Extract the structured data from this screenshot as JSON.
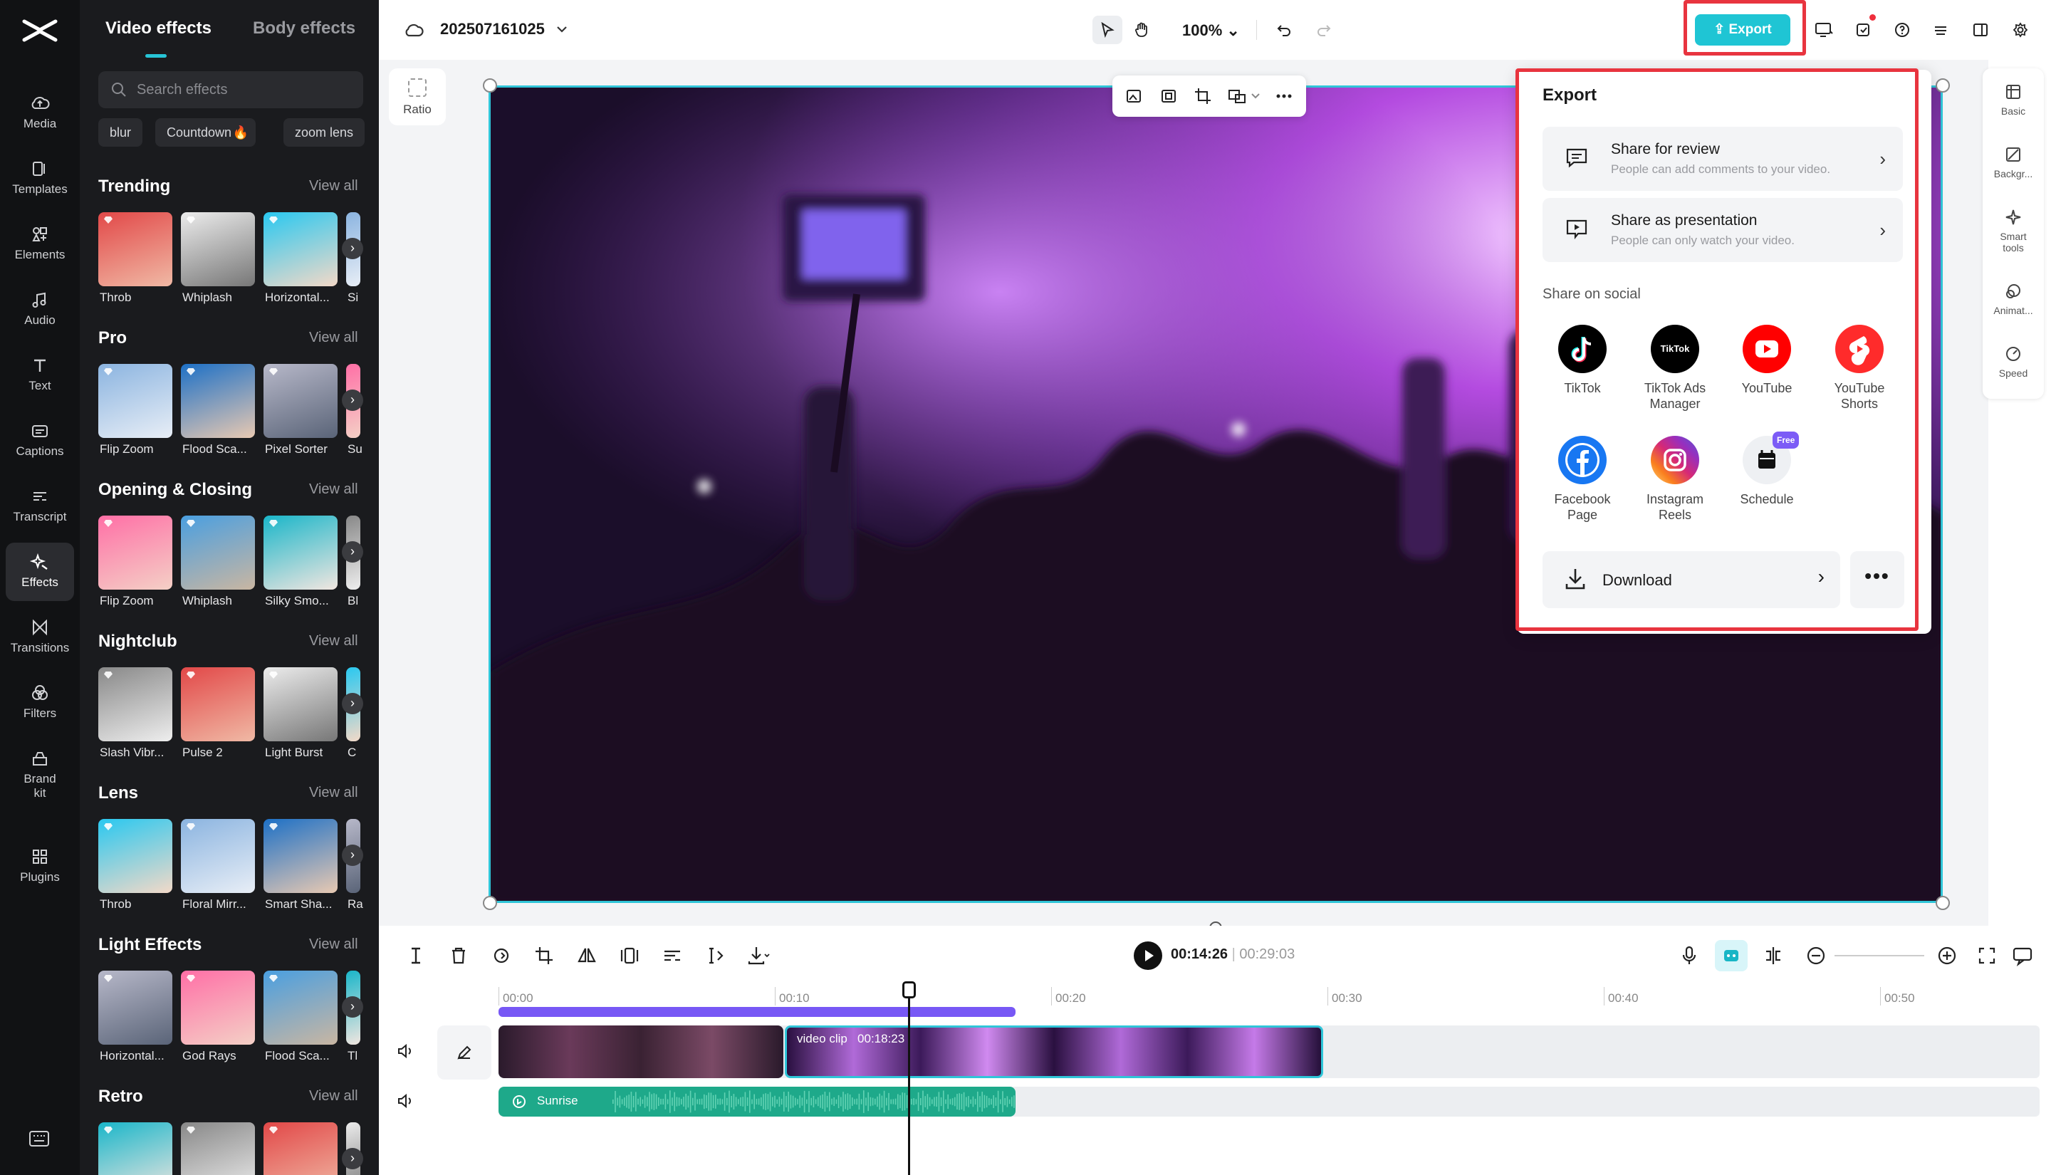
{
  "project": {
    "name": "202507161025",
    "zoom": "100%"
  },
  "rail": {
    "items": [
      {
        "name": "media",
        "label": "Media"
      },
      {
        "name": "templates",
        "label": "Templates"
      },
      {
        "name": "elements",
        "label": "Elements"
      },
      {
        "name": "audio",
        "label": "Audio"
      },
      {
        "name": "text",
        "label": "Text"
      },
      {
        "name": "captions",
        "label": "Captions"
      },
      {
        "name": "transcript",
        "label": "Transcript"
      },
      {
        "name": "effects",
        "label": "Effects",
        "active": true
      },
      {
        "name": "transitions",
        "label": "Transitions"
      },
      {
        "name": "filters",
        "label": "Filters"
      },
      {
        "name": "brand-kit",
        "label": "Brand\nkit"
      },
      {
        "name": "plugins",
        "label": "Plugins"
      }
    ]
  },
  "panel": {
    "tab_active": "Video effects",
    "tab_other": "Body effects",
    "search_placeholder": "Search effects",
    "chips": [
      "blur",
      "Countdown",
      "zoom lens"
    ],
    "view_all": "View all",
    "sections": [
      {
        "title": "Trending",
        "items": [
          "Throb",
          "Whiplash",
          "Horizontal...",
          "Si"
        ]
      },
      {
        "title": "Pro",
        "items": [
          "Flip Zoom",
          "Flood Sca...",
          "Pixel Sorter",
          "Su"
        ]
      },
      {
        "title": "Opening & Closing",
        "items": [
          "Flip Zoom",
          "Whiplash",
          "Silky Smo...",
          "Bl"
        ]
      },
      {
        "title": "Nightclub",
        "items": [
          "Slash Vibr...",
          "Pulse 2",
          "Light Burst",
          "C"
        ]
      },
      {
        "title": "Lens",
        "items": [
          "Throb",
          "Floral Mirr...",
          "Smart Sha...",
          "Ra"
        ]
      },
      {
        "title": "Light Effects",
        "items": [
          "Horizontal...",
          "God Rays",
          "Flood Sca...",
          "Tl"
        ]
      },
      {
        "title": "Retro",
        "items": [
          "",
          "",
          "",
          ""
        ]
      }
    ]
  },
  "toolbar": {
    "export_label": "Export",
    "ratio_label": "Ratio"
  },
  "right_rail": [
    "Basic",
    "Backgr...",
    "Smart\ntools",
    "Animat...",
    "Speed"
  ],
  "export_popup": {
    "title": "Export",
    "share_review": {
      "title": "Share for review",
      "subtitle": "People can add comments to your video."
    },
    "share_presentation": {
      "title": "Share as presentation",
      "subtitle": "People can only watch your video."
    },
    "social_heading": "Share on social",
    "social": [
      {
        "label": "TikTok",
        "color": "#000000"
      },
      {
        "label": "TikTok Ads\nManager",
        "color": "#000000"
      },
      {
        "label": "YouTube",
        "color": "#ff0000"
      },
      {
        "label": "YouTube\nShorts",
        "color": "#ff2b2b"
      },
      {
        "label": "Facebook\nPage",
        "color": "#1877f2"
      },
      {
        "label": "Instagram\nReels",
        "color": "#d62976"
      },
      {
        "label": "Schedule",
        "color": "#eef0f3",
        "badge": "Free"
      }
    ],
    "tiktok_ads_text": "TikTok",
    "download_label": "Download"
  },
  "timeline": {
    "current_time": "00:14:26",
    "total_time": "00:29:03",
    "ruler": [
      "00:00",
      "00:10",
      "00:20",
      "00:30",
      "00:40",
      "00:50"
    ],
    "clip_label": "video clip",
    "clip_duration": "00:18:23",
    "audio_label": "Sunrise"
  },
  "colors": {
    "accent": "#1fc5d4",
    "highlight_red": "#e8343f",
    "clip_selected": "#2fc5d8"
  }
}
